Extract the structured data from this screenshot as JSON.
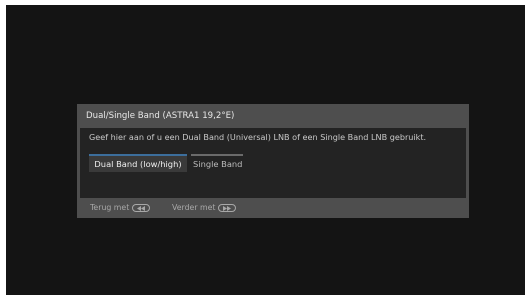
{
  "dialog": {
    "title": "Dual/Single Band (ASTRA1 19,2°E)",
    "prompt": "Geef hier aan of u een Dual Band (Universal) LNB of een Single Band LNB gebruikt.",
    "options": [
      {
        "label": "Dual Band (low/high)",
        "selected": true
      },
      {
        "label": "Single Band",
        "selected": false
      }
    ],
    "footer": {
      "back_label": "Terug met",
      "back_icon": "rewind-key-icon",
      "next_label": "Verder met",
      "next_icon": "fast-forward-key-icon"
    }
  },
  "colors": {
    "screen_background": "#141414",
    "dialog_background": "#4e4e4e",
    "body_background": "#232323",
    "selection_accent": "#3c6e9c"
  }
}
